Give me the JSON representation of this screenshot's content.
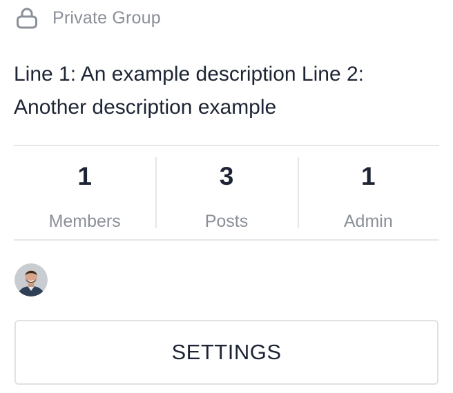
{
  "group": {
    "privacy_icon": "lock-icon",
    "privacy_label": "Private Group",
    "description": "Line 1: An example description Line 2: Another description example"
  },
  "stats": [
    {
      "value": "1",
      "label": "Members"
    },
    {
      "value": "3",
      "label": "Posts"
    },
    {
      "value": "1",
      "label": "Admin"
    }
  ],
  "members_preview": {
    "avatar_icon": "member-avatar"
  },
  "actions": {
    "settings_label": "SETTINGS"
  },
  "colors": {
    "text_primary": "#1d2433",
    "text_muted": "#8a8f98",
    "divider": "#e4e6ea",
    "button_border": "#dfe1e5"
  }
}
